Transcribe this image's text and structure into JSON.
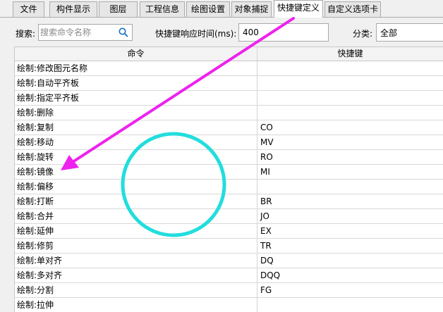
{
  "tabs": [
    {
      "label": "文件",
      "active": false
    },
    {
      "label": "构件显示",
      "active": false
    },
    {
      "label": "图层",
      "active": false
    },
    {
      "label": "工程信息",
      "active": false
    },
    {
      "label": "绘图设置",
      "active": false
    },
    {
      "label": "对象捕捉",
      "active": false
    },
    {
      "label": "快捷键定义",
      "active": true
    },
    {
      "label": "自定义选项卡",
      "active": false
    }
  ],
  "toolbar": {
    "search_label": "搜索:",
    "search_placeholder": "搜索命令名称",
    "response_time_label": "快捷键响应时间(ms):",
    "response_time_value": "400",
    "category_label": "分类:",
    "category_value": "全部"
  },
  "table": {
    "columns": [
      "命令",
      "快捷键"
    ],
    "rows": [
      {
        "command": "绘制:修改图元名称",
        "shortcut": ""
      },
      {
        "command": "绘制:自动平齐板",
        "shortcut": ""
      },
      {
        "command": "绘制:指定平齐板",
        "shortcut": ""
      },
      {
        "command": "绘制:删除",
        "shortcut": ""
      },
      {
        "command": "绘制:复制",
        "shortcut": "CO"
      },
      {
        "command": "绘制:移动",
        "shortcut": "MV"
      },
      {
        "command": "绘制:旋转",
        "shortcut": "RO"
      },
      {
        "command": "绘制:镜像",
        "shortcut": "MI"
      },
      {
        "command": "绘制:偏移",
        "shortcut": ""
      },
      {
        "command": "绘制:打断",
        "shortcut": "BR"
      },
      {
        "command": "绘制:合并",
        "shortcut": "JO"
      },
      {
        "command": "绘制:延伸",
        "shortcut": "EX"
      },
      {
        "command": "绘制:修剪",
        "shortcut": "TR"
      },
      {
        "command": "绘制:单对齐",
        "shortcut": "DQ"
      },
      {
        "command": "绘制:多对齐",
        "shortcut": "DQQ"
      },
      {
        "command": "绘制:分割",
        "shortcut": "FG"
      },
      {
        "command": "绘制:拉伸",
        "shortcut": ""
      }
    ]
  },
  "annotations": {
    "arrow_color": "#ee22ee",
    "circle_color": "#22dddd",
    "accent_color": "#1a6fc4"
  },
  "icons": {
    "search": "search-icon"
  }
}
